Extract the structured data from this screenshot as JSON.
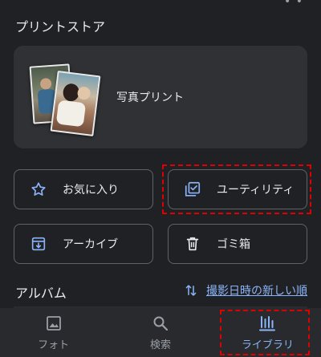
{
  "header": {
    "title": "プリントストア"
  },
  "print_card": {
    "label": "写真プリント"
  },
  "buttons": {
    "favorites": "お気に入り",
    "utilities": "ユーティリティ",
    "archive": "アーカイブ",
    "trash": "ゴミ箱"
  },
  "albums": {
    "title": "アルバム",
    "sort_label": "撮影日時の新しい順"
  },
  "nav": {
    "items": [
      {
        "label": "フォト",
        "icon": "photo-icon",
        "active": false
      },
      {
        "label": "検索",
        "icon": "search-icon",
        "active": false
      },
      {
        "label": "ライブラリ",
        "icon": "library-icon",
        "active": true
      }
    ]
  },
  "colors": {
    "background": "#202124",
    "card": "#303134",
    "accent": "#8ab4f8",
    "highlight": "#e00000"
  }
}
